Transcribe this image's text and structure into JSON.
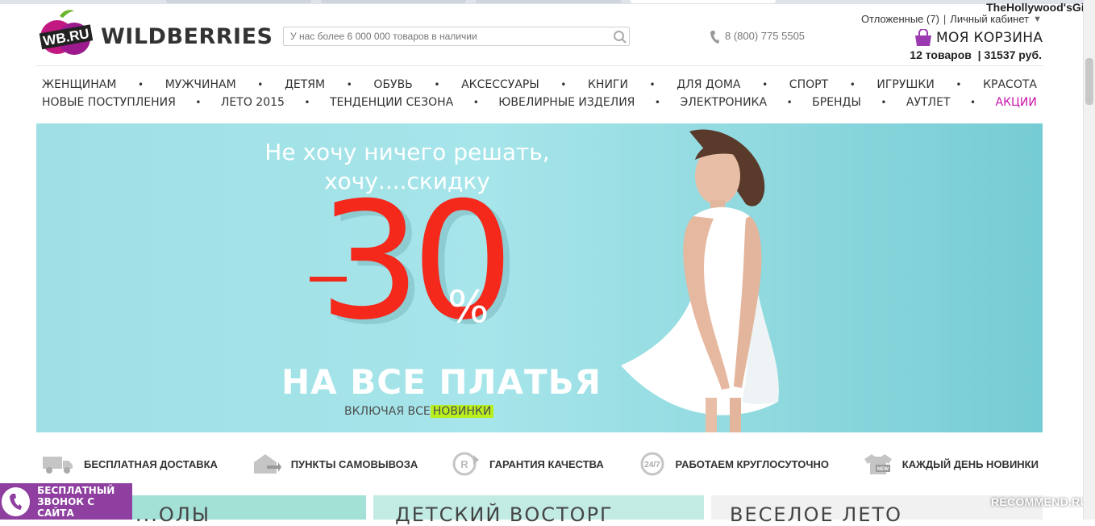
{
  "watermark": "TheHollywood'sGirl",
  "header": {
    "logo_text": "WB.RU",
    "brand": "WILDBERRIES",
    "search_placeholder": "У нас более 6 000 000 товаров в наличии",
    "phone": "8 (800) 775 5505",
    "deferred": "Отложенные (7)",
    "account": "Личный кабинет",
    "cart_title": "МОЯ КОРЗИНА",
    "cart_items": "12 товаров",
    "cart_total": "31537 руб."
  },
  "nav_row1": [
    "ЖЕНЩИНАМ",
    "МУЖЧИНАМ",
    "ДЕТЯМ",
    "ОБУВЬ",
    "АКСЕССУАРЫ",
    "КНИГИ",
    "ДЛЯ ДОМА",
    "СПОРТ",
    "ИГРУШКИ",
    "КРАСОТА"
  ],
  "nav_row2": [
    "НОВЫЕ ПОСТУПЛЕНИЯ",
    "ЛЕТО 2015",
    "ТЕНДЕНЦИИ СЕЗОНА",
    "ЮВЕЛИРНЫЕ ИЗДЕЛИЯ",
    "ЭЛЕКТРОНИКА",
    "БРЕНДЫ",
    "АУТЛЕТ",
    "АКЦИИ"
  ],
  "banner": {
    "line1": "Не хочу ничего решать,",
    "line2": "хочу....скидку",
    "number": "30",
    "percent": "%",
    "subtitle": "НА ВСЕ ПЛАТЬЯ",
    "including": "ВКЛЮЧАЯ ВСЕ",
    "highlight": "НОВИНКИ"
  },
  "features": [
    {
      "label": "БЕСПЛАТНАЯ ДОСТАВКА",
      "icon": "truck-icon"
    },
    {
      "label": "ПУНКТЫ САМОВЫВОЗА",
      "icon": "pickup-icon"
    },
    {
      "label": "ГАРАНТИЯ КАЧЕСТВА",
      "icon": "quality-icon"
    },
    {
      "label": "РАБОТАЕМ КРУГЛОСУТОЧНО",
      "icon": "clock-24-7-icon"
    },
    {
      "label": "КАЖДЫЙ ДЕНЬ НОВИНКИ",
      "icon": "new-shirt-icon"
    }
  ],
  "callback": {
    "line1": "БЕСПЛАТНЫЙ",
    "line2": "ЗВОНОК С САЙТА"
  },
  "tiles": [
    "...ОЛЫ",
    "ДЕТСКИЙ ВОСТОРГ",
    "ВЕСЕЛОЕ ЛЕТО"
  ],
  "recommend": "RECOMMEND.RU",
  "colors": {
    "accent": "#cb11ab",
    "sale_red": "#f4281b",
    "banner_bg": "#9ee0e6",
    "highlight": "#b8ef1f",
    "callback_bg": "#8e3fa0"
  }
}
